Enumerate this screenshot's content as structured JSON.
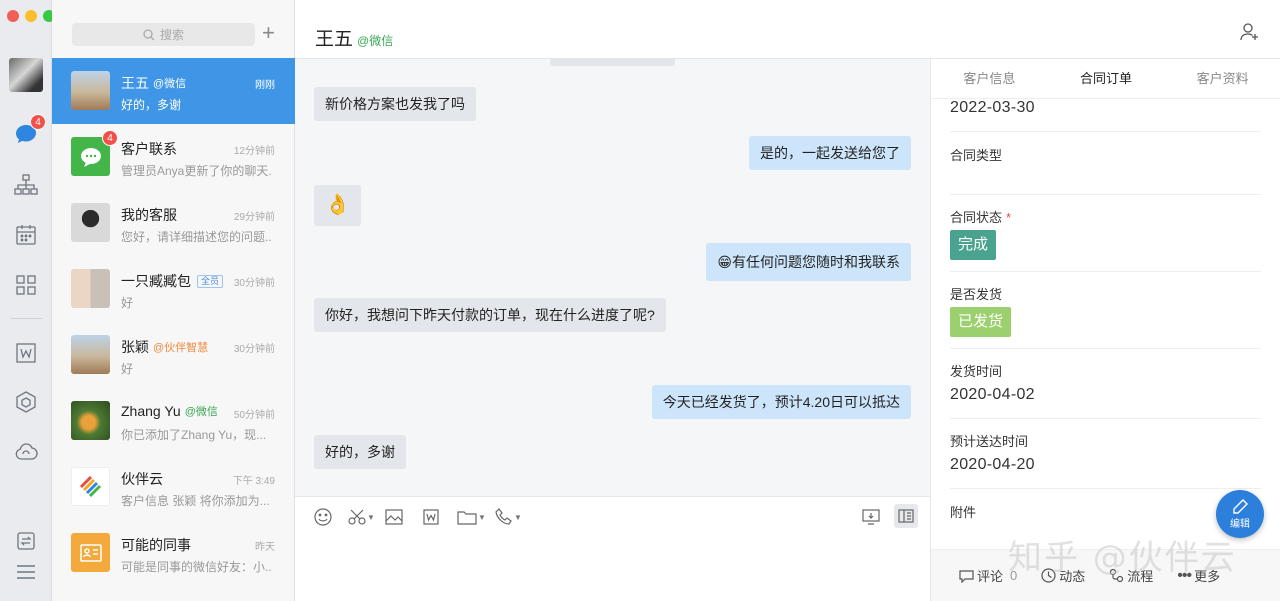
{
  "window": {
    "traffic_lights": [
      "#f25f58",
      "#fbbe2e",
      "#38c844"
    ]
  },
  "rail": {
    "items": [
      {
        "icon": "avatar"
      },
      {
        "icon": "chat-bubble-icon",
        "badge": "4"
      },
      {
        "icon": "org-chart-icon"
      },
      {
        "icon": "calendar-icon"
      },
      {
        "icon": "apps-grid-icon"
      },
      {
        "icon": "doc-w-icon"
      },
      {
        "icon": "hexagon-icon"
      },
      {
        "icon": "cloud-icon"
      },
      {
        "icon": "switch-icon"
      },
      {
        "icon": "menu-icon"
      }
    ]
  },
  "list": {
    "search_placeholder": "搜索",
    "conversations": [
      {
        "name": "王五",
        "tag": "@微信",
        "time": "刚刚",
        "preview": "好的，多谢",
        "active": true
      },
      {
        "name": "客户联系",
        "tag": "",
        "time": "12分钟前",
        "preview": "管理员Anya更新了你的聊天...",
        "badge": "4"
      },
      {
        "name": "我的客服",
        "tag": "",
        "time": "29分钟前",
        "preview": "您好，请详细描述您的问题..."
      },
      {
        "name": "一只臧臧包",
        "tag": "全员",
        "time": "30分钟前",
        "preview": "好"
      },
      {
        "name": "张颖",
        "tag": "@伙伴智慧",
        "time": "30分钟前",
        "preview": "好"
      },
      {
        "name": "Zhang Yu",
        "tag": "@微信",
        "time": "50分钟前",
        "preview": "你已添加了Zhang Yu，现..."
      },
      {
        "name": "伙伴云",
        "tag": "",
        "time": "下午 3:49",
        "preview": "客户信息 张颖 将你添加为..."
      },
      {
        "name": "可能的同事",
        "tag": "",
        "time": "昨天",
        "preview": "可能是同事的微信好友：小..."
      }
    ]
  },
  "chat": {
    "title": "王五",
    "title_tag": "@微信",
    "messages": [
      {
        "dir": "in",
        "text": "新价格方案也发我了吗"
      },
      {
        "dir": "out",
        "text": "是的，一起发送给您了"
      },
      {
        "dir": "in",
        "text": "👌"
      },
      {
        "dir": "out",
        "text": "😁有任何问题您随时和我联系"
      },
      {
        "dir": "in",
        "text": "你好，我想问下昨天付款的订单，现在什么进度了呢?"
      },
      {
        "dir": "out",
        "text": "今天已经发货了，预计4.20日可以抵达"
      },
      {
        "dir": "in",
        "text": "好的，多谢"
      }
    ]
  },
  "panel": {
    "tabs": [
      "客户信息",
      "合同订单",
      "客户资料"
    ],
    "active_tab": "合同订单",
    "first_value": "2022-03-30",
    "contract_type_label": "合同类型",
    "contract_status_label": "合同状态",
    "contract_status_value": "完成",
    "shipped_label": "是否发货",
    "shipped_value": "已发货",
    "ship_time_label": "发货时间",
    "ship_time_value": "2020-04-02",
    "eta_label": "预计送达时间",
    "eta_value": "2020-04-20",
    "attachment_label": "附件",
    "edit_label": "编辑",
    "footer": {
      "comment_label": "评论",
      "comment_count": "0",
      "activity_label": "动态",
      "flow_label": "流程",
      "more_label": "更多"
    },
    "status_colors": {
      "done": "#4aa38f",
      "shipped": "#9ccf6e"
    }
  },
  "watermark": "知乎 @伙伴云"
}
